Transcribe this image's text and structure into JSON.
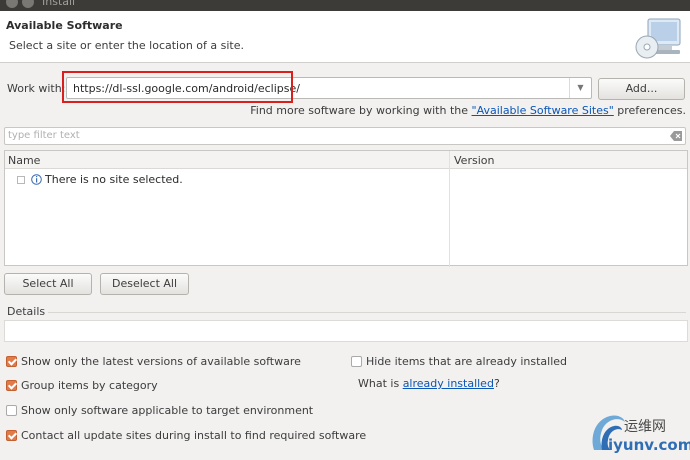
{
  "window": {
    "title": "Install"
  },
  "banner": {
    "title": "Available Software",
    "description": "Select a site or enter the location of a site."
  },
  "work_with": {
    "label": "Work with:",
    "value": "https://dl-ssl.google.com/android/eclipse/",
    "add_label": "Add...",
    "find_more_prefix": "Find more software by working with the ",
    "find_more_link": "\"Available Software Sites\"",
    "find_more_suffix": " preferences."
  },
  "filter": {
    "placeholder": "type filter text"
  },
  "table": {
    "columns": [
      "Name",
      "Version"
    ],
    "rows": [
      {
        "name": "There is no site selected.",
        "version": ""
      }
    ]
  },
  "buttons": {
    "select_all": "Select All",
    "deselect_all": "Deselect All"
  },
  "details": {
    "label": "Details"
  },
  "options": {
    "latest_versions": {
      "label": "Show only the latest versions of available software",
      "checked": true
    },
    "group_by_category": {
      "label": "Group items by category",
      "checked": true
    },
    "target_env": {
      "label": "Show only software applicable to target environment",
      "checked": false
    },
    "contact_sites": {
      "label": "Contact all update sites during install to find required software",
      "checked": true
    },
    "hide_installed": {
      "label": "Hide items that are already installed",
      "checked": false
    },
    "what_is_prefix": "What is ",
    "what_is_link": "already installed",
    "what_is_suffix": "?"
  },
  "watermark": {
    "chinese": "运维网",
    "url": "iyunv.com"
  },
  "colors": {
    "link": "#0b55b5",
    "checkbox_checked": "#e27b4a",
    "highlight_box": "#d9201d"
  }
}
